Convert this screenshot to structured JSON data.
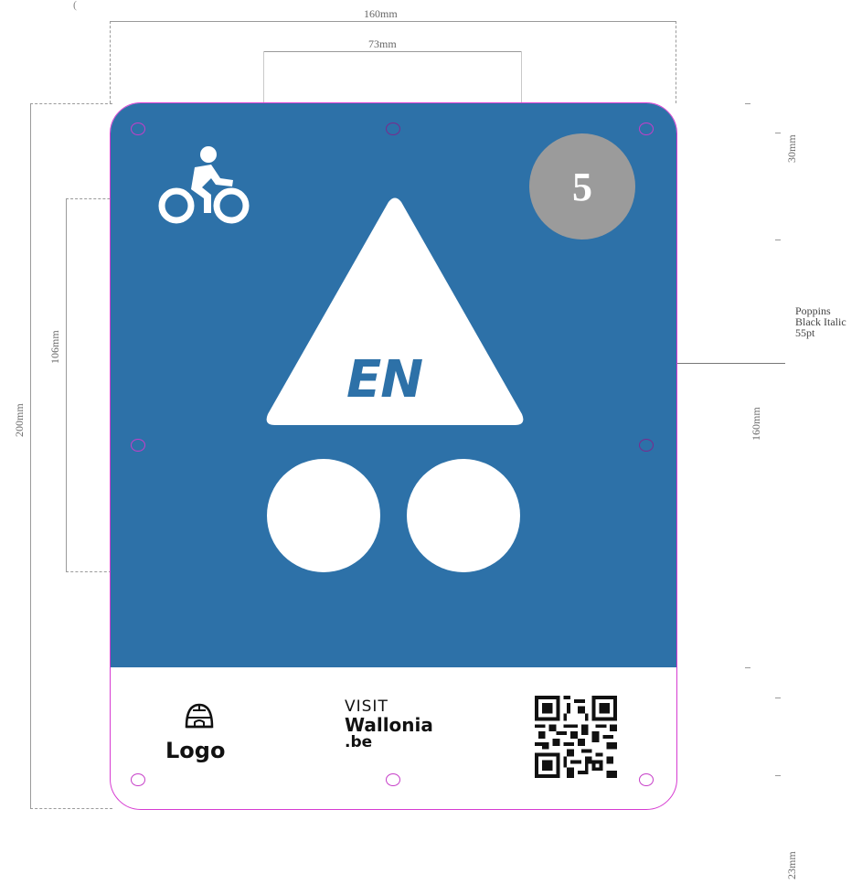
{
  "dimensions": {
    "top_width": "160mm",
    "inner_width": "73mm",
    "total_height": "200mm",
    "symbol_height": "106mm",
    "right_top": "30mm",
    "right_mid": "160mm",
    "right_bottom": "23mm"
  },
  "font_note": {
    "line1": "Poppins",
    "line2": "Black Italic",
    "line3": "55pt"
  },
  "sign": {
    "number": "5",
    "language_code": "EN",
    "logo_label": "Logo",
    "visit_line1": "VISIT",
    "visit_line2": "Wallonia",
    "visit_line3": ".be"
  },
  "colors": {
    "sign_blue": "#2d71a8",
    "badge_grey": "#9b9b9b",
    "cut_outline": "#d63bd1"
  },
  "icons": [
    "bicycle-icon",
    "igloo-icon",
    "qr-code"
  ]
}
